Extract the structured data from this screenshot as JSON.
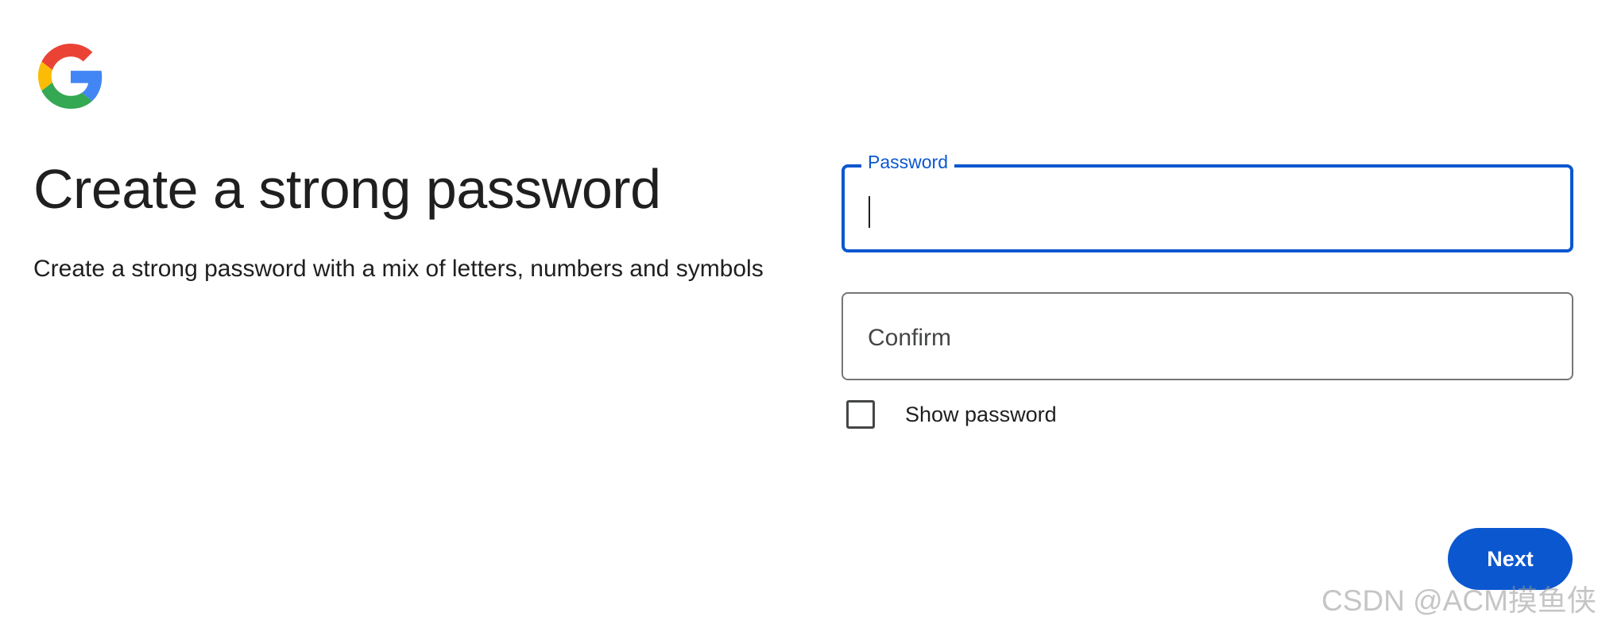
{
  "brand": {
    "logo_icon": "google-g-logo"
  },
  "heading": {
    "title": "Create a strong password",
    "description": "Create a strong password with a mix of letters, numbers and symbols"
  },
  "form": {
    "password": {
      "label": "Password",
      "value": ""
    },
    "confirm": {
      "placeholder": "Confirm",
      "value": ""
    },
    "show_password": {
      "label": "Show password",
      "checked": false
    }
  },
  "actions": {
    "next_label": "Next"
  },
  "watermark": "CSDN @ACM摸鱼侠",
  "colors": {
    "accent": "#0b57d0",
    "text": "#1f1f1f",
    "border": "#747775",
    "background": "#ffffff"
  }
}
